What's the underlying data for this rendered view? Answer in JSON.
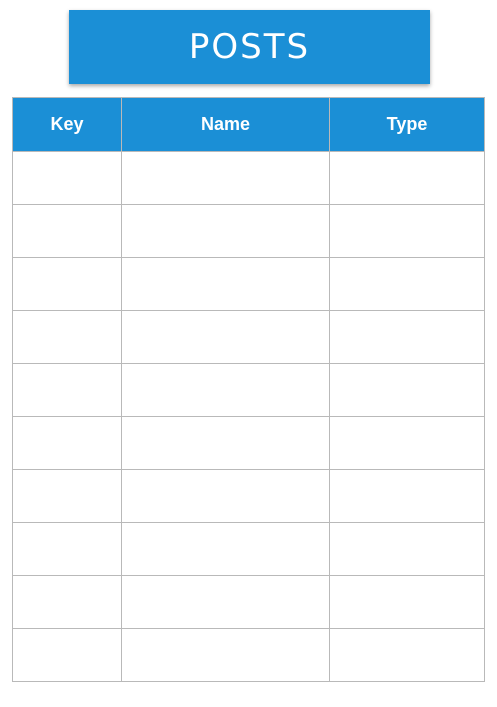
{
  "title": "POSTS",
  "columns": [
    "Key",
    "Name",
    "Type"
  ],
  "rows": [
    [
      "",
      "",
      ""
    ],
    [
      "",
      "",
      ""
    ],
    [
      "",
      "",
      ""
    ],
    [
      "",
      "",
      ""
    ],
    [
      "",
      "",
      ""
    ],
    [
      "",
      "",
      ""
    ],
    [
      "",
      "",
      ""
    ],
    [
      "",
      "",
      ""
    ],
    [
      "",
      "",
      ""
    ],
    [
      "",
      "",
      ""
    ]
  ],
  "colors": {
    "header": "#1b8fd6",
    "border": "#b9b9b9",
    "header_text": "#ffffff"
  }
}
